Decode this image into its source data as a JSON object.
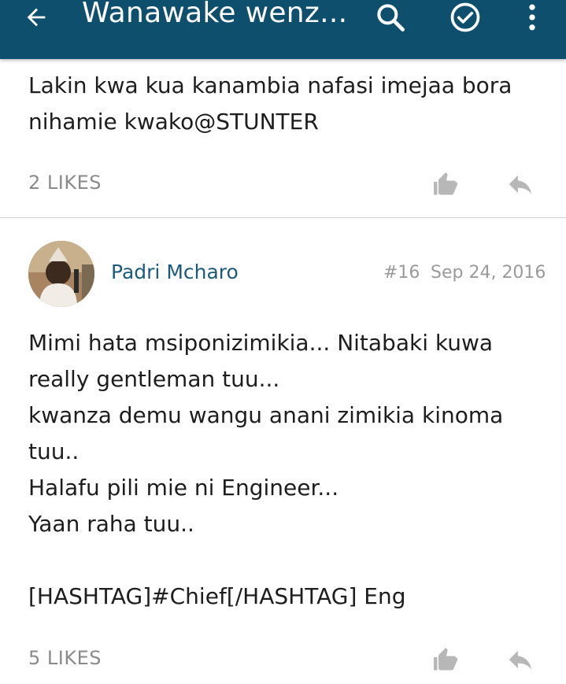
{
  "header": {
    "title": "Wanawake wenz...",
    "bg_color": "#0e4f6e"
  },
  "posts": [
    {
      "body": "Lakin kwa kua kanambia nafasi imejaa bora\nnihamie kwako@STUNTER",
      "likes": "2 LIKES"
    },
    {
      "author": "Padri Mcharo",
      "number": "#16",
      "date": "Sep 24, 2016",
      "body": "Mimi hata msiponizimikia... Nitabaki kuwa\nreally gentleman tuu...\nkwanza demu wangu anani zimikia kinoma\ntuu..\nHalafu pili mie ni Engineer...\nYaan raha tuu..\n\n[HASHTAG]#Chief[/HASHTAG] Eng",
      "likes": "5 LIKES"
    }
  ],
  "icons": {
    "back": "arrow-left-icon",
    "search": "search-icon",
    "check": "check-circle-icon",
    "more": "more-vert-icon",
    "like": "thumbs-up-icon",
    "reply": "reply-icon"
  }
}
